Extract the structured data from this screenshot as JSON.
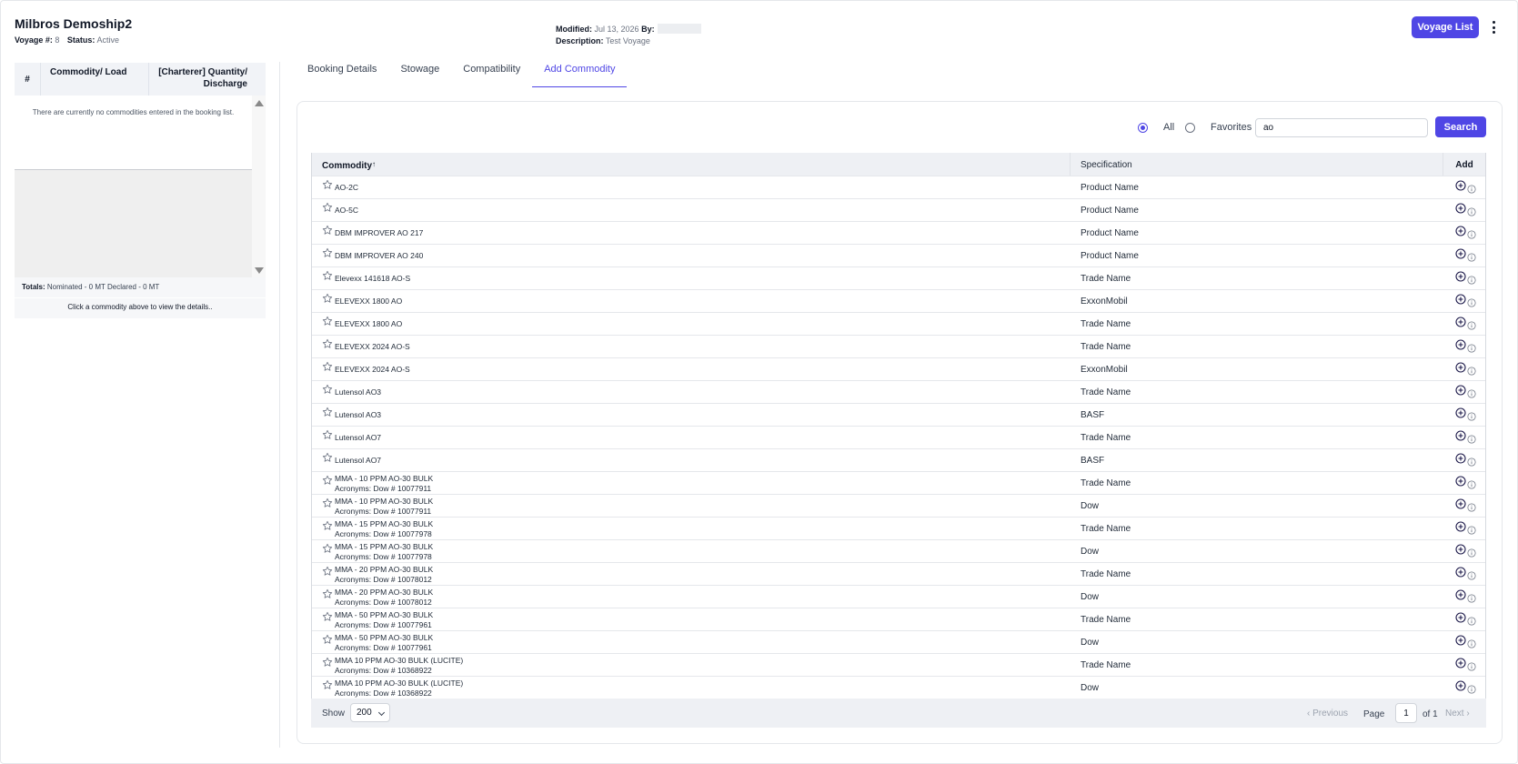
{
  "header": {
    "title": "Milbros Demoship2",
    "voyage_label": "Voyage #:",
    "voyage_value": "8",
    "status_label": "Status:",
    "status_value": "Active",
    "modified_label": "Modified:",
    "modified_value": "Jul 13, 2026",
    "by_label": "By:",
    "description_label": "Description:",
    "description_value": "Test Voyage",
    "voyage_list_button": "Voyage List",
    "menu_icon": "more-vertical-icon"
  },
  "booking_list": {
    "col_number": "#",
    "col_commodity": "Commodity/ Load",
    "col_quantity": "[Charterer] Quantity/ Discharge",
    "empty_message": "There are currently no commodities entered in the booking list.",
    "totals_label": "Totals:",
    "totals_value": "Nominated - 0 MT Declared - 0 MT",
    "click_hint": "Click a commodity above to view the details.."
  },
  "tabs": [
    {
      "label": "Booking Details",
      "active": false
    },
    {
      "label": "Stowage",
      "active": false
    },
    {
      "label": "Compatibility",
      "active": false
    },
    {
      "label": "Add Commodity",
      "active": true
    }
  ],
  "filter": {
    "all_label": "All",
    "favorites_label": "Favorites",
    "selected": "All",
    "search_value": "ao",
    "search_button": "Search"
  },
  "table": {
    "headers": {
      "commodity": "Commodity",
      "sort_indicator": "↑",
      "specification": "Specification",
      "add": "Add"
    },
    "rows": [
      {
        "name": "AO-2C",
        "acronyms": "",
        "spec": "Product Name"
      },
      {
        "name": "AO-5C",
        "acronyms": "",
        "spec": "Product Name"
      },
      {
        "name": "DBM IMPROVER AO 217",
        "acronyms": "",
        "spec": "Product Name"
      },
      {
        "name": "DBM IMPROVER AO 240",
        "acronyms": "",
        "spec": "Product Name"
      },
      {
        "name": "Elevexx 141618 AO-S",
        "acronyms": "",
        "spec": "Trade Name"
      },
      {
        "name": "ELEVEXX 1800 AO",
        "acronyms": "",
        "spec": "ExxonMobil"
      },
      {
        "name": "ELEVEXX 1800 AO",
        "acronyms": "",
        "spec": "Trade Name"
      },
      {
        "name": "ELEVEXX 2024 AO-S",
        "acronyms": "",
        "spec": "Trade Name"
      },
      {
        "name": "ELEVEXX 2024 AO-S",
        "acronyms": "",
        "spec": "ExxonMobil"
      },
      {
        "name": "Lutensol AO3",
        "acronyms": "",
        "spec": "Trade Name"
      },
      {
        "name": "Lutensol AO3",
        "acronyms": "",
        "spec": "BASF"
      },
      {
        "name": "Lutensol AO7",
        "acronyms": "",
        "spec": "Trade Name"
      },
      {
        "name": "Lutensol AO7",
        "acronyms": "",
        "spec": "BASF"
      },
      {
        "name": "MMA - 10 PPM AO-30 BULK",
        "acronyms": "Acronyms: Dow # 10077911",
        "spec": "Trade Name"
      },
      {
        "name": "MMA - 10 PPM AO-30 BULK",
        "acronyms": "Acronyms: Dow # 10077911",
        "spec": "Dow"
      },
      {
        "name": "MMA - 15 PPM AO-30 BULK",
        "acronyms": "Acronyms: Dow # 10077978",
        "spec": "Trade Name"
      },
      {
        "name": "MMA - 15 PPM AO-30 BULK",
        "acronyms": "Acronyms: Dow # 10077978",
        "spec": "Dow"
      },
      {
        "name": "MMA - 20 PPM AO-30 BULK",
        "acronyms": "Acronyms: Dow # 10078012",
        "spec": "Trade Name"
      },
      {
        "name": "MMA - 20 PPM AO-30 BULK",
        "acronyms": "Acronyms: Dow # 10078012",
        "spec": "Dow"
      },
      {
        "name": "MMA - 50 PPM AO-30 BULK",
        "acronyms": "Acronyms: Dow # 10077961",
        "spec": "Trade Name"
      },
      {
        "name": "MMA - 50 PPM AO-30 BULK",
        "acronyms": "Acronyms: Dow # 10077961",
        "spec": "Dow"
      },
      {
        "name": "MMA 10 PPM AO-30 BULK (LUCITE)",
        "acronyms": "Acronyms: Dow # 10368922",
        "spec": "Trade Name"
      },
      {
        "name": "MMA 10 PPM AO-30 BULK (LUCITE)",
        "acronyms": "Acronyms: Dow # 10368922",
        "spec": "Dow"
      }
    ]
  },
  "pagination": {
    "show_label": "Show",
    "page_size": "200",
    "previous_label": "Previous",
    "page_label": "Page",
    "page_value": "1",
    "of_label": "of 1",
    "next_label": "Next"
  },
  "colors": {
    "accent": "#4f46e5"
  }
}
